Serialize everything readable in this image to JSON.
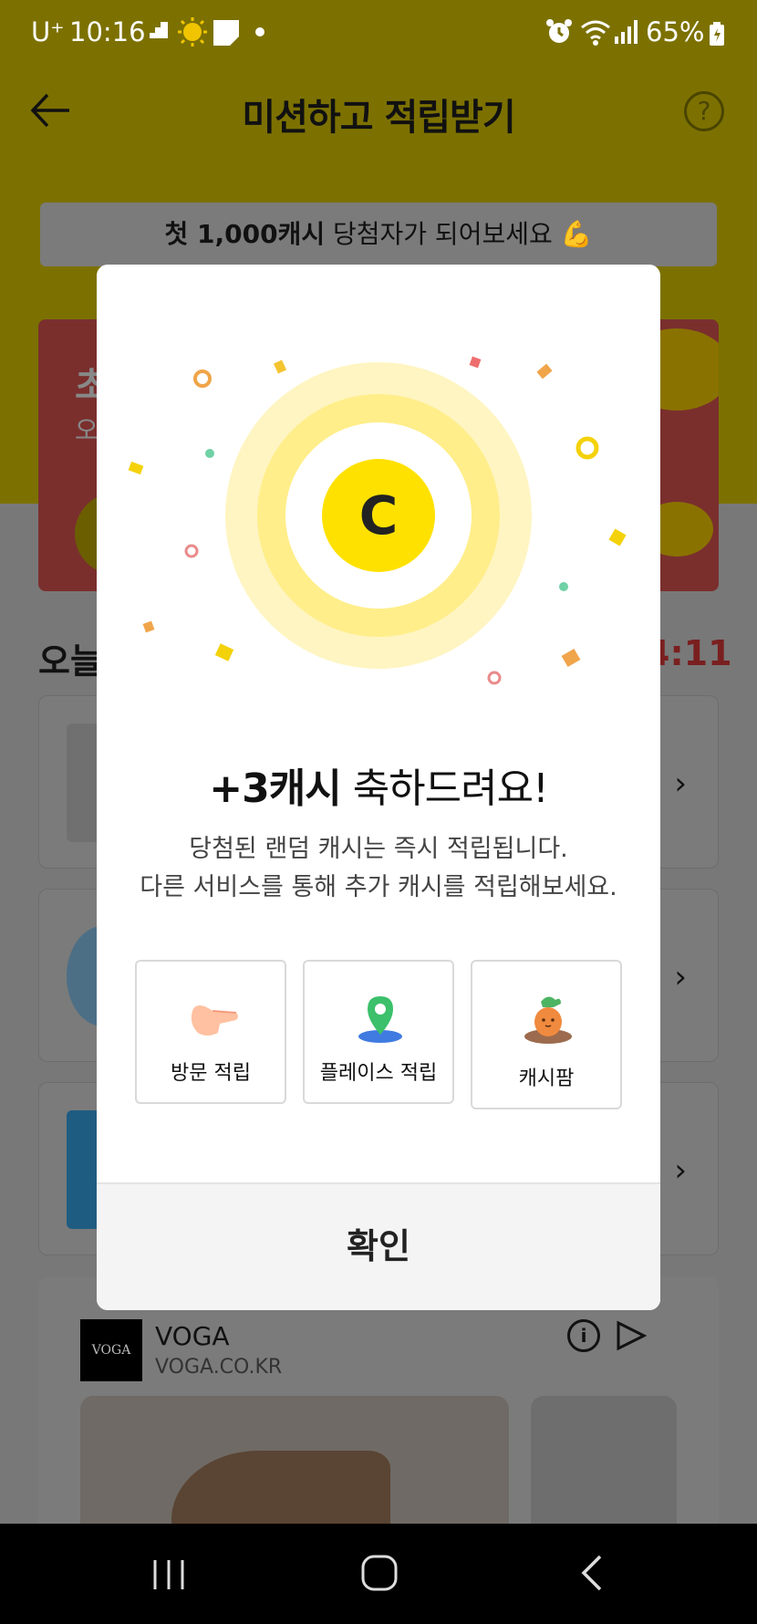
{
  "status_bar": {
    "carrier": "U⁺",
    "time": "10:16",
    "battery": "65%"
  },
  "header": {
    "title": "미션하고 적립받기"
  },
  "promo_banner": {
    "bold": "첫 1,000캐시",
    "rest": " 당첨자가 되어보세요 💪"
  },
  "red_card": {
    "title_fragment": "초",
    "subtitle_fragment": "오"
  },
  "today": {
    "title_fragment": "오늘",
    "timer_fragment": "4:11"
  },
  "ad": {
    "name": "VOGA",
    "url": "VOGA.CO.KR",
    "logo_text": "VOGA"
  },
  "modal": {
    "title_bold": "+3캐시",
    "title_rest": " 축하드려요!",
    "desc_line1": "당첨된 랜덤 캐시는 즉시 적립됩니다.",
    "desc_line2": "다른 서비스를 통해 추가 캐시를 적립해보세요.",
    "services": [
      {
        "label": "방문 적립",
        "icon": "pointing-hand-icon"
      },
      {
        "label": "플레이스 적립",
        "icon": "map-pin-icon"
      },
      {
        "label": "캐시팜",
        "icon": "carrot-icon"
      }
    ],
    "confirm_label": "확인",
    "coin_letter": "C"
  },
  "colors": {
    "accent_yellow": "#FFE100",
    "ring_light": "#FFF5C2",
    "ring_mid": "#FFEE8A"
  }
}
